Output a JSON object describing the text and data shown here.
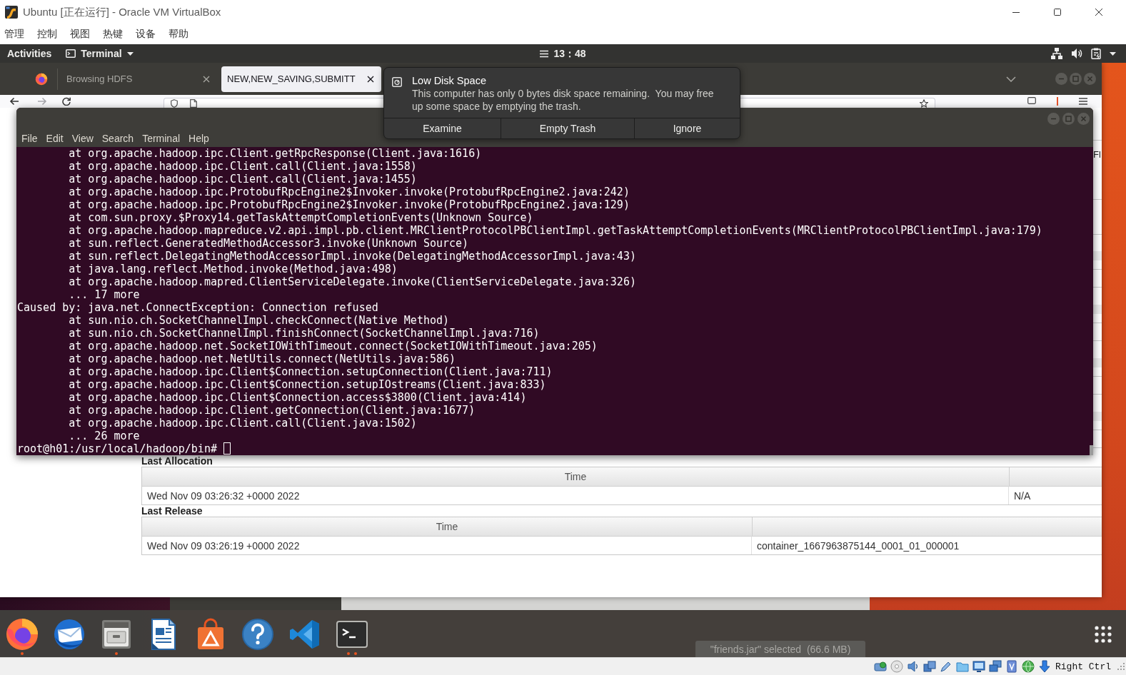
{
  "window": {
    "title": "Ubuntu [正在运行] - Oracle VM VirtualBox"
  },
  "menu": [
    "管理",
    "控制",
    "视图",
    "热键",
    "设备",
    "帮助"
  ],
  "top_bar": {
    "activities": "Activities",
    "app_menu": "Terminal",
    "clock": "13：48"
  },
  "browser": {
    "tabs": [
      {
        "label": "Browsing HDFS",
        "selected": false
      },
      {
        "label": "NEW,NEW_SAVING,SUBMITT",
        "selected": true
      }
    ],
    "page": {
      "edge_header": "Fl",
      "sections": [
        {
          "title": "Last Allocation",
          "columns": [
            "Time"
          ],
          "rows": [
            [
              "Wed Nov 09 03:26:32 +0000 2022",
              "N/A"
            ]
          ]
        },
        {
          "title": "Last Release",
          "columns": [
            "Time"
          ],
          "rows": [
            [
              "Wed Nov 09 03:26:19 +0000 2022",
              "container_1667963875144_0001_01_000001"
            ]
          ]
        }
      ]
    }
  },
  "terminal": {
    "menu": [
      "File",
      "Edit",
      "View",
      "Search",
      "Terminal",
      "Help"
    ],
    "lines": [
      {
        "text": "at org.apache.hadoop.ipc.Client.getRpcResponse(Client.java:1616)",
        "indented": true
      },
      {
        "text": "at org.apache.hadoop.ipc.Client.call(Client.java:1558)",
        "indented": true
      },
      {
        "text": "at org.apache.hadoop.ipc.Client.call(Client.java:1455)",
        "indented": true
      },
      {
        "text": "at org.apache.hadoop.ipc.ProtobufRpcEngine2$Invoker.invoke(ProtobufRpcEngine2.java:242)",
        "indented": true
      },
      {
        "text": "at org.apache.hadoop.ipc.ProtobufRpcEngine2$Invoker.invoke(ProtobufRpcEngine2.java:129)",
        "indented": true
      },
      {
        "text": "at com.sun.proxy.$Proxy14.getTaskAttemptCompletionEvents(Unknown Source)",
        "indented": true
      },
      {
        "text": "at org.apache.hadoop.mapreduce.v2.api.impl.pb.client.MRClientProtocolPBClientImpl.getTaskAttemptCompletionEvents(MRClientProtocolPBClientImpl.java:179)",
        "indented": true
      },
      {
        "text": "at sun.reflect.GeneratedMethodAccessor3.invoke(Unknown Source)",
        "indented": true
      },
      {
        "text": "at sun.reflect.DelegatingMethodAccessorImpl.invoke(DelegatingMethodAccessorImpl.java:43)",
        "indented": true
      },
      {
        "text": "at java.lang.reflect.Method.invoke(Method.java:498)",
        "indented": true
      },
      {
        "text": "at org.apache.hadoop.mapred.ClientServiceDelegate.invoke(ClientServiceDelegate.java:326)",
        "indented": true
      },
      {
        "text": "... 17 more",
        "indented": true
      },
      {
        "text": "Caused by: java.net.ConnectException: Connection refused",
        "indented": false
      },
      {
        "text": "at sun.nio.ch.SocketChannelImpl.checkConnect(Native Method)",
        "indented": true
      },
      {
        "text": "at sun.nio.ch.SocketChannelImpl.finishConnect(SocketChannelImpl.java:716)",
        "indented": true
      },
      {
        "text": "at org.apache.hadoop.net.SocketIOWithTimeout.connect(SocketIOWithTimeout.java:205)",
        "indented": true
      },
      {
        "text": "at org.apache.hadoop.net.NetUtils.connect(NetUtils.java:586)",
        "indented": true
      },
      {
        "text": "at org.apache.hadoop.ipc.Client$Connection.setupConnection(Client.java:711)",
        "indented": true
      },
      {
        "text": "at org.apache.hadoop.ipc.Client$Connection.setupIOstreams(Client.java:833)",
        "indented": true
      },
      {
        "text": "at org.apache.hadoop.ipc.Client$Connection.access$3800(Client.java:414)",
        "indented": true
      },
      {
        "text": "at org.apache.hadoop.ipc.Client.getConnection(Client.java:1677)",
        "indented": true
      },
      {
        "text": "at org.apache.hadoop.ipc.Client.call(Client.java:1502)",
        "indented": true
      },
      {
        "text": "... 26 more",
        "indented": true
      }
    ],
    "prompt": "root@h01:/usr/local/hadoop/bin#"
  },
  "notification": {
    "title": "Low Disk Space",
    "body": "This computer has only 0 bytes disk space remaining.  You may free up some space by emptying the trash.",
    "buttons": [
      "Examine",
      "Empty Trash",
      "Ignore"
    ]
  },
  "dock": {
    "apps": [
      {
        "kind": "browser",
        "running": true,
        "multiple_windows": false
      },
      {
        "kind": "mail",
        "running": false,
        "multiple_windows": false
      },
      {
        "kind": "files",
        "running": true,
        "multiple_windows": false
      },
      {
        "kind": "writer",
        "running": false,
        "multiple_windows": false
      },
      {
        "kind": "software",
        "running": false,
        "multiple_windows": false
      },
      {
        "kind": "help",
        "running": false,
        "multiple_windows": false
      },
      {
        "kind": "editor",
        "running": false,
        "multiple_windows": false
      },
      {
        "kind": "terminal",
        "running": true,
        "multiple_windows": true
      }
    ],
    "file_status": "\"friends.jar\" selected  (66.6 MB)"
  },
  "status_bar": {
    "host_key": "Right Ctrl"
  }
}
